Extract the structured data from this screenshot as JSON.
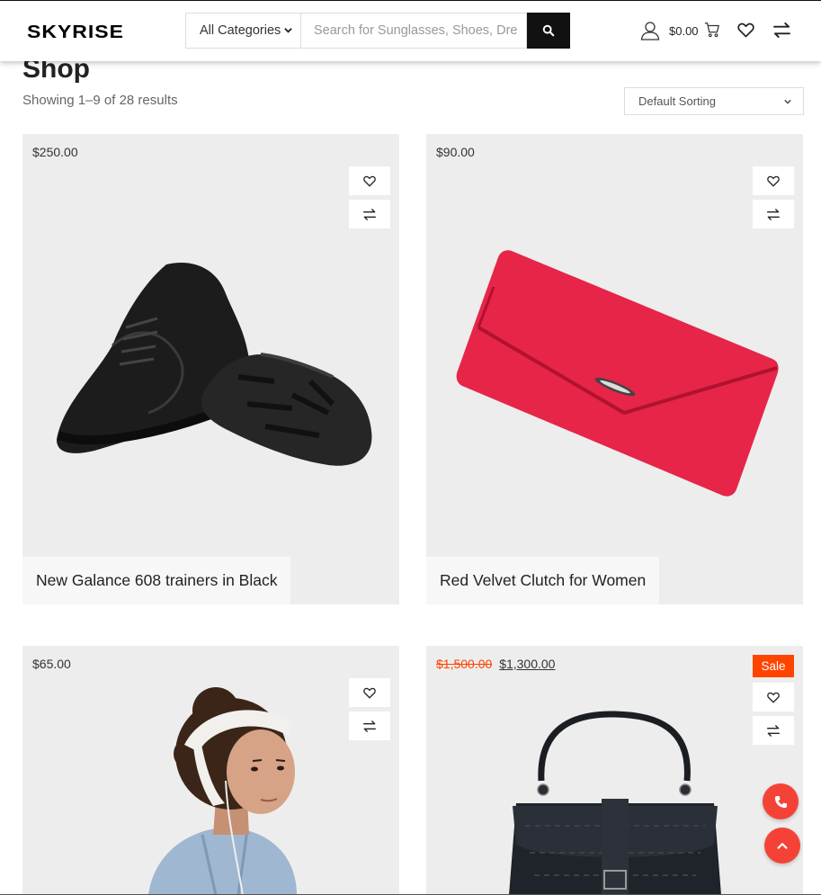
{
  "header": {
    "logo_text": "SKYRISE",
    "category_select": "All Categories",
    "search_placeholder": "Search for Sunglasses, Shoes, Dre",
    "cart_amount": "$0.00",
    "icons": [
      "user-icon",
      "cart-icon",
      "heart-icon",
      "compare-icon",
      "search-icon"
    ]
  },
  "page": {
    "title": "Shop",
    "result_count": "Showing 1–9 of 28 results",
    "sorting": "Default Sorting"
  },
  "products": [
    {
      "price": "$250.00",
      "name": "New Galance 608 trainers in Black"
    },
    {
      "price": "$90.00",
      "name": "Red Velvet Clutch for Women"
    },
    {
      "price": "$65.00",
      "name": ""
    },
    {
      "old_price": "$1,500.00",
      "price": "$1,300.00",
      "badge": "Sale",
      "name": ""
    }
  ],
  "colors": {
    "accent": "#ff4400",
    "float_button": "#f44336",
    "card_bg": "#eeeded",
    "search_button": "#111111"
  }
}
